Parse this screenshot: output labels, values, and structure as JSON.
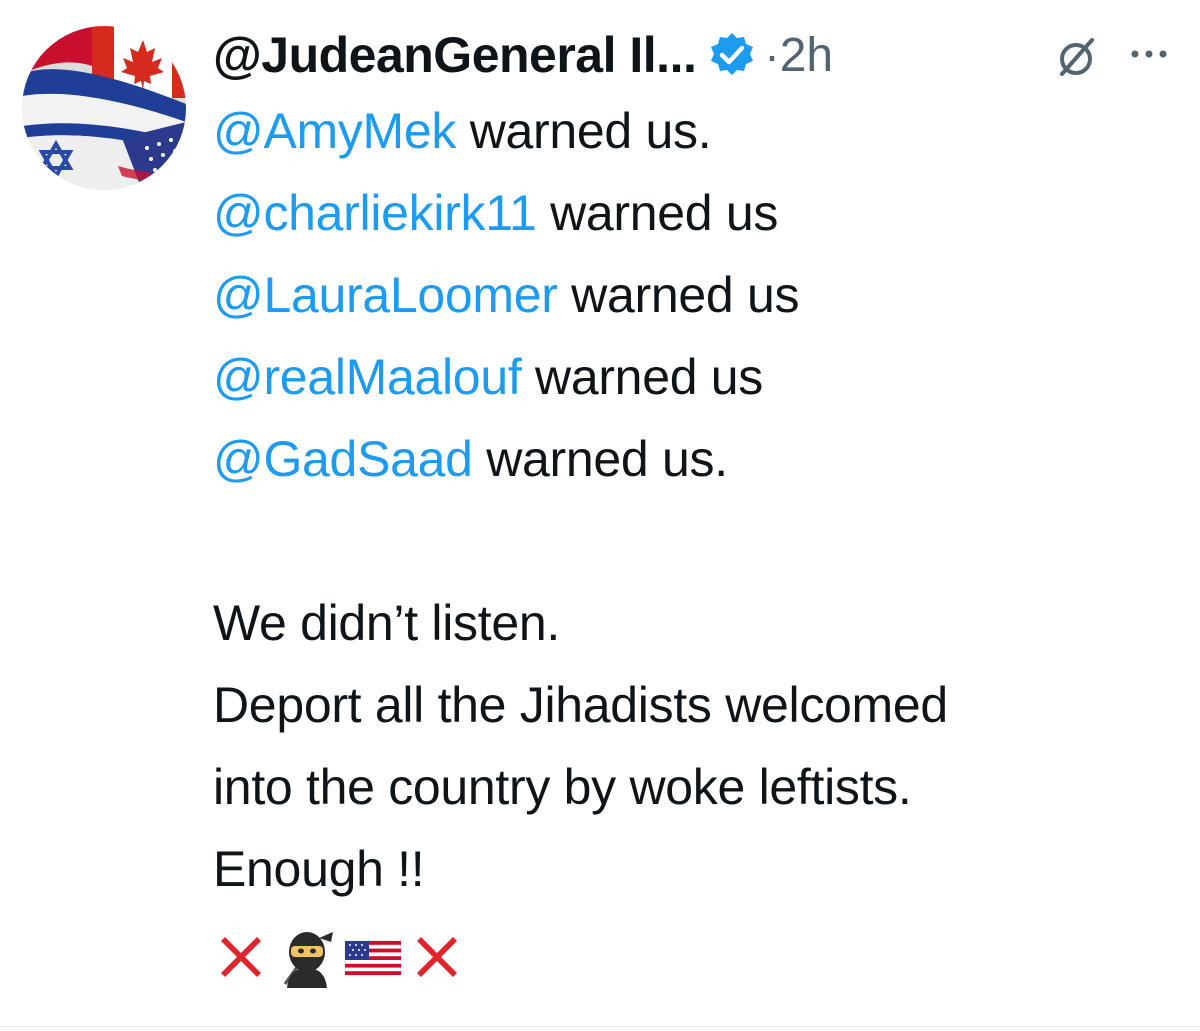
{
  "tweet": {
    "display_name": "@JudeanGeneral Il...",
    "separator": "·",
    "time": "2h",
    "lines": [
      {
        "mention": "@AmyMek",
        "text": " warned us."
      },
      {
        "mention": "@charliekirk11",
        "text": " warned us"
      },
      {
        "mention": "@LauraLoomer",
        "text": " warned us"
      },
      {
        "mention": "@realMaalouf",
        "text": " warned us"
      },
      {
        "mention": "@GadSaad",
        "text": " warned us."
      }
    ],
    "paragraph": [
      "We didn’t listen.",
      "Deport all the Jihadists welcomed",
      "into the country by woke leftists.",
      "Enough !!"
    ],
    "emojis": [
      "cross-mark-icon",
      "ninja-icon",
      "us-flag-icon",
      "cross-mark-icon"
    ]
  },
  "icons": {
    "verified": "verified-badge-icon",
    "grok": "grok-icon",
    "more": "more-icon",
    "avatar": "avatar-flags-image"
  },
  "colors": {
    "mention": "#1d9bf0",
    "verified": "#1d9bf0",
    "text": "#0f1419",
    "secondary": "#536471",
    "cross": "#e0242b"
  }
}
